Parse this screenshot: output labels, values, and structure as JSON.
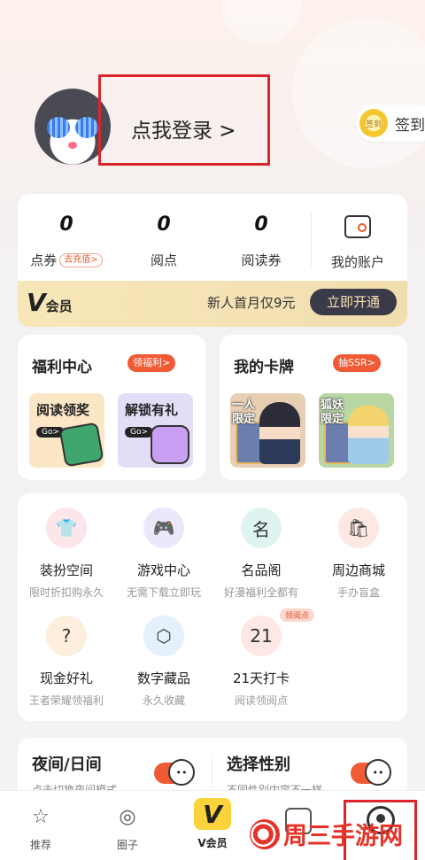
{
  "header": {
    "login_label": "点我登录 >",
    "checkin_coin": "签到",
    "checkin_label": "签到"
  },
  "stats": [
    {
      "value": "0",
      "label": "点券",
      "tag": "去充值>"
    },
    {
      "value": "0",
      "label": "阅点"
    },
    {
      "value": "0",
      "label": "阅读券"
    }
  ],
  "account": {
    "label": "我的账户",
    "icon": "wallet-icon"
  },
  "vip": {
    "logo_v": "V",
    "logo_text": "会员",
    "promo": "新人首月仅9元",
    "button": "立即开通"
  },
  "welfare": {
    "title": "福利中心",
    "tag": "领福利>",
    "tiles": [
      {
        "title": "阅读领奖",
        "go": "Go>"
      },
      {
        "title": "解锁有礼",
        "go": "Go>"
      }
    ]
  },
  "cards": {
    "title": "我的卡牌",
    "tag": "抽SSR>",
    "tiles": [
      {
        "badge": "一人限定"
      },
      {
        "badge": "狐妖限定"
      }
    ]
  },
  "services": [
    {
      "name": "装扮空间",
      "sub": "限时折扣购永久",
      "icon": "tshirt-icon",
      "glyph": "👕"
    },
    {
      "name": "游戏中心",
      "sub": "无需下载立即玩",
      "icon": "gamepad-icon",
      "glyph": "🎮"
    },
    {
      "name": "名品阁",
      "sub": "好漫福利全都有",
      "icon": "brand-icon",
      "glyph": "名"
    },
    {
      "name": "周边商城",
      "sub": "手办盲盒",
      "icon": "shop-icon",
      "glyph": "🛍"
    },
    {
      "name": "现金好礼",
      "sub": "王者荣耀领福利",
      "icon": "giftbox-icon",
      "glyph": "?"
    },
    {
      "name": "数字藏品",
      "sub": "永久收藏",
      "icon": "cube-icon",
      "glyph": "⬡"
    },
    {
      "name": "21天打卡",
      "sub": "阅读领阅点",
      "icon": "calendar-icon",
      "glyph": "21",
      "badge": "领阅点"
    }
  ],
  "settings": [
    {
      "title": "夜间/日间",
      "desc": "点击切换夜间模式"
    },
    {
      "title": "选择性别",
      "desc": "不同性别内容不一样"
    }
  ],
  "tabs": [
    {
      "label": "推荐",
      "icon": "star-icon",
      "glyph": "☆"
    },
    {
      "label": "圈子",
      "icon": "circle-icon",
      "glyph": "◎"
    },
    {
      "label": "V会员",
      "icon": "vip-icon",
      "glyph": "V"
    }
  ],
  "watermark": {
    "text": "周三手游网"
  }
}
